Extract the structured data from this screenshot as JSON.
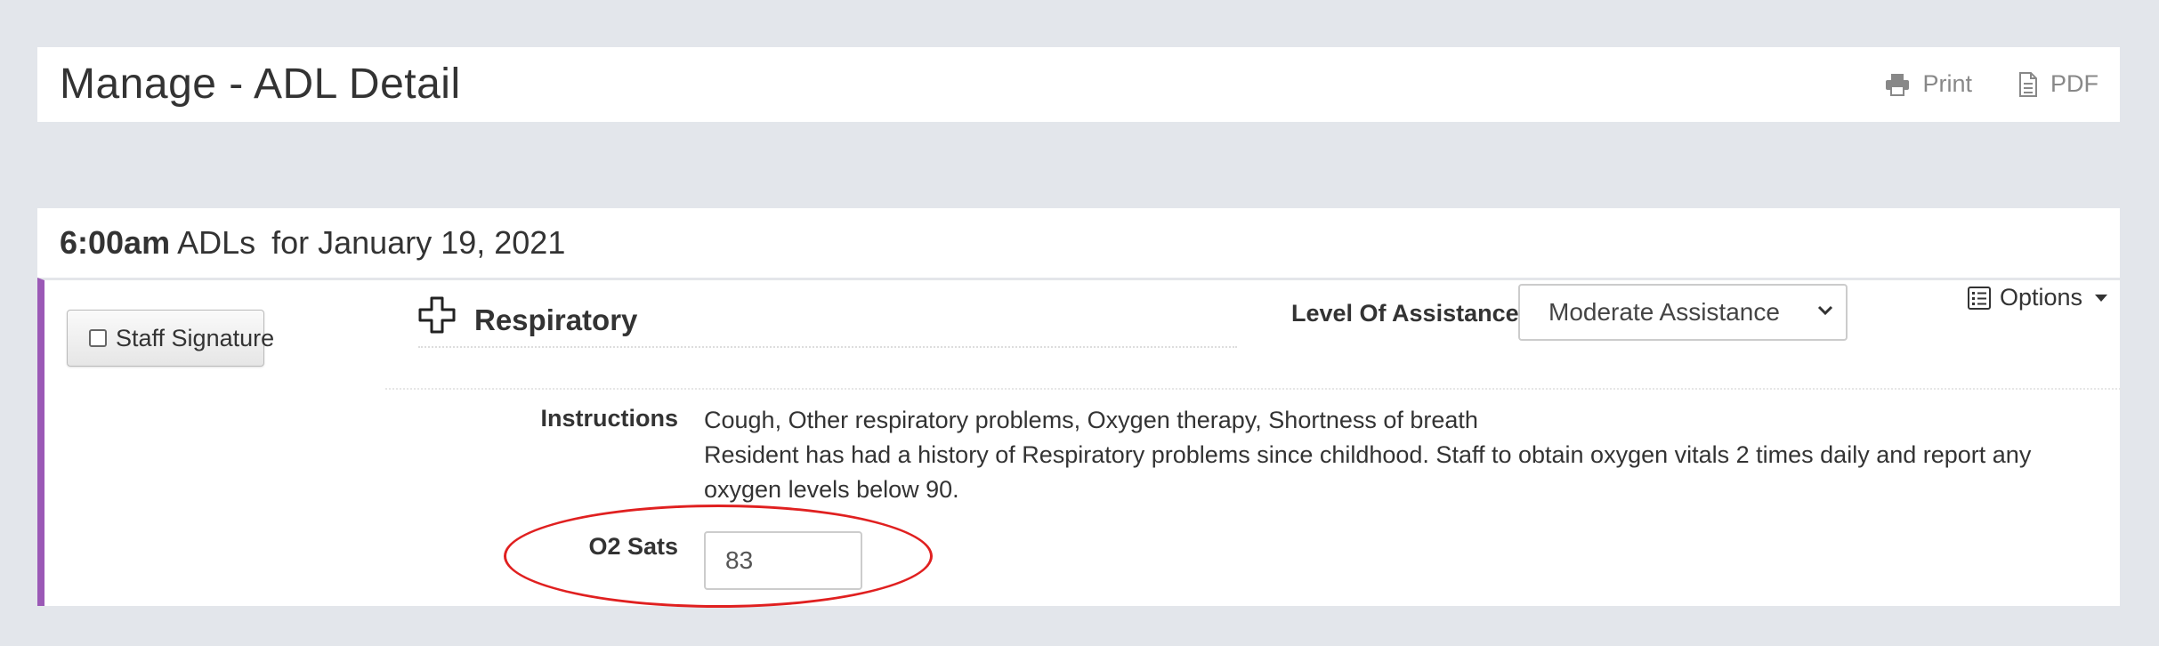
{
  "header": {
    "title": "Manage - ADL Detail",
    "actions": [
      {
        "label": "Print",
        "icon": "printer-icon"
      },
      {
        "label": "PDF",
        "icon": "document-icon"
      }
    ]
  },
  "adl": {
    "time": "6:00am",
    "label": "ADLs",
    "for_text": "for January 19, 2021",
    "accent_color": "#9b59b6",
    "staff_signature": {
      "label": "Staff Signature",
      "checked": false
    },
    "section": {
      "title": "Respiratory",
      "icon": "cross-outline-icon"
    },
    "level_of_assistance": {
      "label": "Level Of Assistance:",
      "selected": "Moderate Assistance"
    },
    "options": {
      "label": "Options",
      "icon": "list-icon"
    },
    "instructions": {
      "label": "Instructions",
      "lines": [
        "Cough, Other respiratory problems, Oxygen therapy, Shortness of breath",
        "Resident has had a history of Respiratory problems since childhood. Staff to obtain oxygen vitals 2 times daily and report any oxygen levels below 90."
      ]
    },
    "o2_sats": {
      "label": "O2 Sats",
      "value": "83"
    }
  },
  "annotation": {
    "color": "#e02020"
  }
}
